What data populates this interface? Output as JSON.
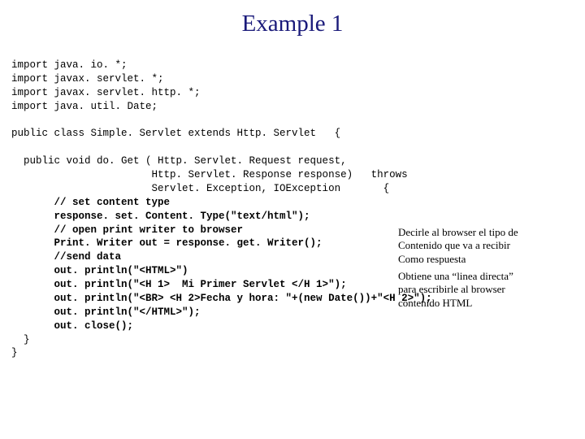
{
  "title": "Example 1",
  "imports": {
    "l1": "import java. io. *;",
    "l2": "import javax. servlet. *;",
    "l3": "import javax. servlet. http. *;",
    "l4": "import java. util. Date;"
  },
  "classdecl": "public class Simple. Servlet extends Http. Servlet   {",
  "method": {
    "sig1": "  public void do. Get ( Http. Servlet. Request request,",
    "sig2": "                       Http. Servlet. Response response)   throws",
    "sig3": "                       Servlet. Exception, IOException       {",
    "c1": "       // set content type",
    "l1": "       response. set. Content. Type(\"text/html\");",
    "c2": "       // open print writer to browser",
    "l2": "       Print. Writer out = response. get. Writer();",
    "c3": "       //send data",
    "l3": "       out. println(\"<HTML>\")",
    "l4": "       out. println(\"<H 1>  Mi Primer Servlet </H 1>\");",
    "l5": "       out. println(\"<BR> <H 2>Fecha y hora: \"+(new Date())+\"<H 2>\");",
    "l6": "       out. println(\"</HTML>\");",
    "l7": "       out. close();",
    "end1": "  }",
    "end2": "}"
  },
  "annotations": {
    "a1l1": "Decirle al browser el tipo de",
    "a1l2": "Contenido que va a recibir",
    "a1l3": "Como respuesta",
    "a2l1": "Obtiene una “linea directa”",
    "a2l2": "para escribirle al browser",
    "a2l3": "contenido HTML"
  }
}
